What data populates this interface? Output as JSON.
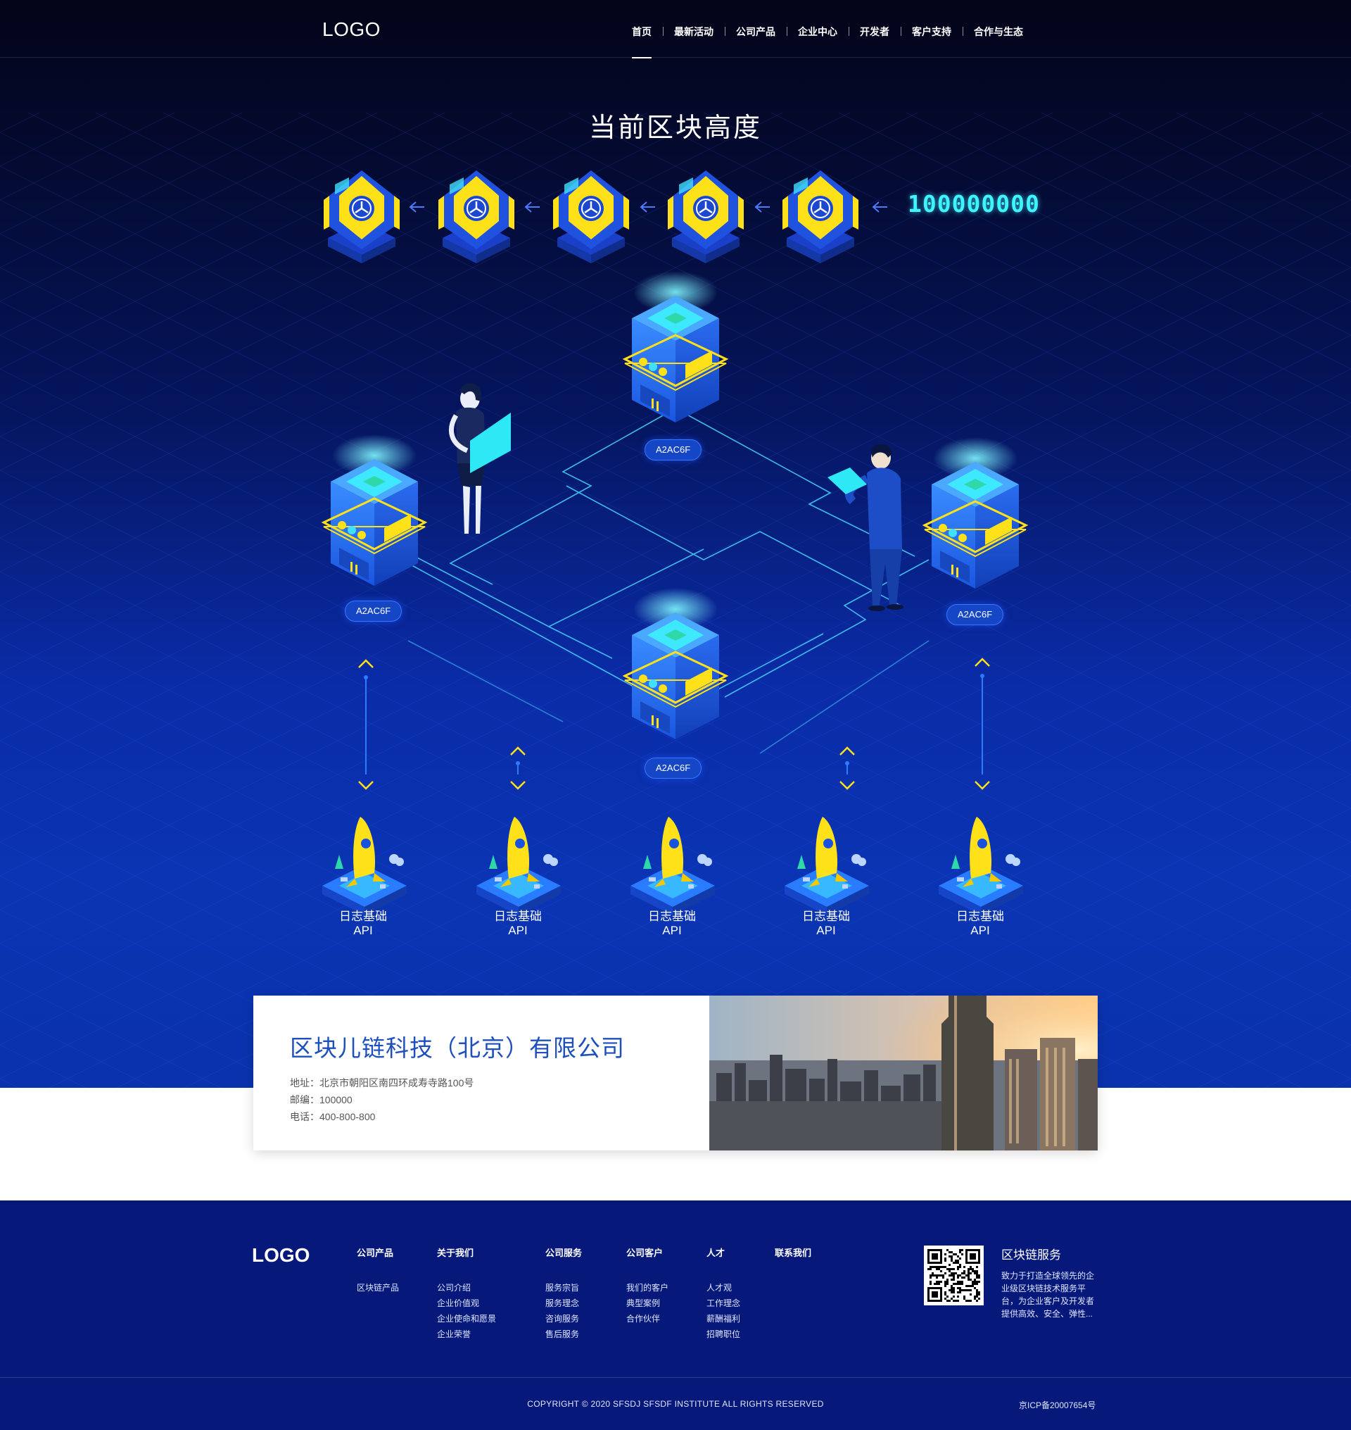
{
  "header": {
    "logo": "LOGO",
    "nav": [
      "首页",
      "最新活动",
      "公司产品",
      "企业中心",
      "开发者",
      "客户支持",
      "合作与生态"
    ],
    "active_index": 0
  },
  "block_section": {
    "title": "当前区块高度",
    "height_value": "100000000",
    "chain_blocks": 5
  },
  "network": {
    "nodes": [
      {
        "label": "A2AC6F"
      },
      {
        "label": "A2AC6F"
      },
      {
        "label": "A2AC6F"
      },
      {
        "label": "A2AC6F"
      }
    ],
    "apis": [
      {
        "title": "日志基础",
        "subtitle": "API"
      },
      {
        "title": "日志基础",
        "subtitle": "API"
      },
      {
        "title": "日志基础",
        "subtitle": "API"
      },
      {
        "title": "日志基础",
        "subtitle": "API"
      },
      {
        "title": "日志基础",
        "subtitle": "API"
      }
    ]
  },
  "company": {
    "name": "区块儿链科技（北京）有限公司",
    "address": "地址：北京市朝阳区南四环成寿寺路100号",
    "postcode": "邮编：100000",
    "phone": "电话：400-800-800"
  },
  "footer": {
    "logo": "LOGO",
    "columns": [
      {
        "title": "公司产品",
        "links": [
          "区块链产品"
        ]
      },
      {
        "title": "关于我们",
        "links": [
          "公司介绍",
          "企业价值观",
          "企业使命和愿景",
          "企业荣誉"
        ]
      },
      {
        "title": "公司服务",
        "links": [
          "服务宗旨",
          "服务理念",
          "咨询服务",
          "售后服务"
        ]
      },
      {
        "title": "公司客户",
        "links": [
          "我们的客户",
          "典型案例",
          "合作伙伴"
        ]
      },
      {
        "title": "人才",
        "links": [
          "人才观",
          "工作理念",
          "薪酬福利",
          "招聘职位"
        ]
      },
      {
        "title": "联系我们",
        "links": []
      }
    ],
    "service_title": "区块链服务",
    "service_desc": "致力于打造全球领先的企业级区块链技术服务平台，为企业客户及开发者提供高效、安全、弹性...",
    "copyright": "COPYRIGHT © 2020 SFSDJ SFSDF INSTITUTE ALL RIGHTS RESERVED",
    "icp": "京ICP备20007654号"
  },
  "colors": {
    "accent_cyan": "#3ff4ff",
    "brand_blue": "#1d4fbf",
    "footer_bg": "#06187a",
    "highlight_yellow": "#ffe11a"
  }
}
